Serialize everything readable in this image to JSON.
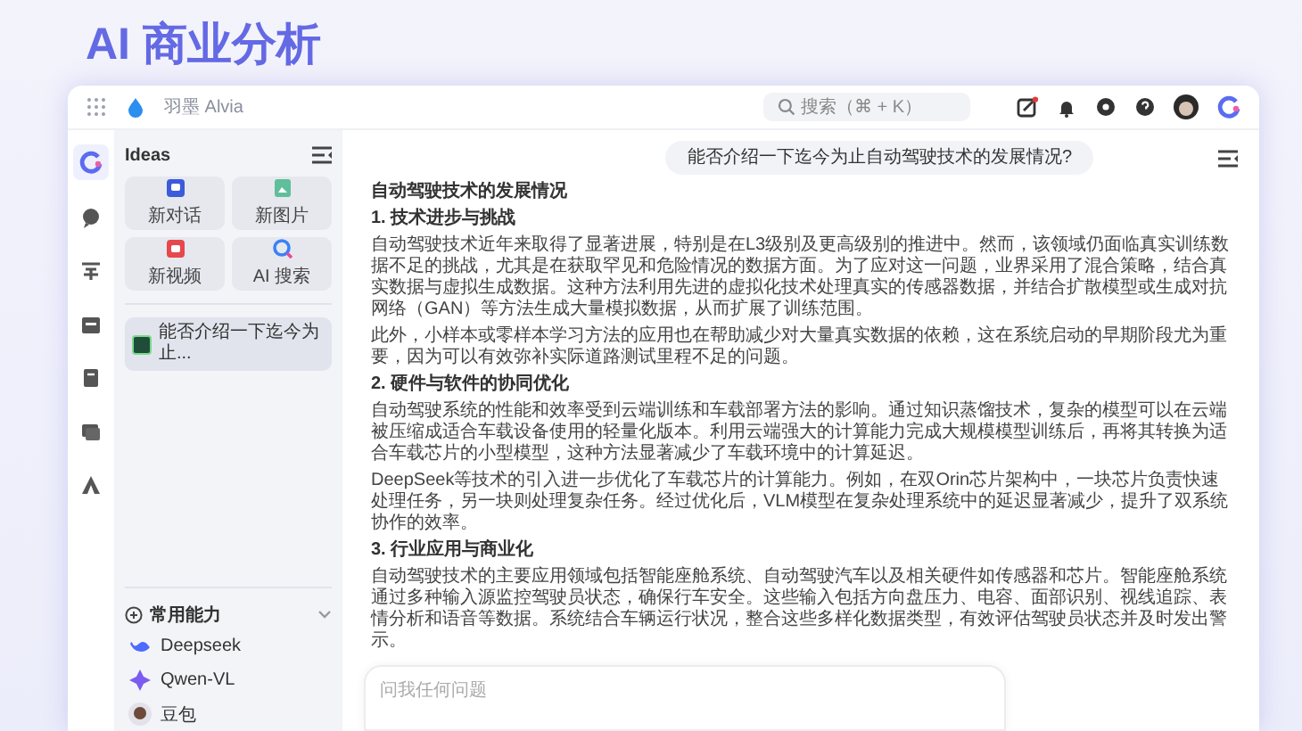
{
  "page_title": "AI 商业分析",
  "topbar": {
    "app_name": "羽墨 Alvia",
    "search": {
      "placeholder": "搜索（⌘ + K）"
    },
    "notification_dot": true
  },
  "rail": {
    "items": [
      {
        "kind": "logo",
        "selected": true
      },
      {
        "kind": "chat",
        "selected": false
      },
      {
        "kind": "list",
        "selected": false
      },
      {
        "kind": "calendar",
        "selected": false
      },
      {
        "kind": "note",
        "selected": false
      },
      {
        "kind": "message",
        "selected": false
      },
      {
        "kind": "triangle",
        "selected": false
      }
    ]
  },
  "sidebar": {
    "title": "Ideas",
    "tiles": [
      {
        "kind": "chat",
        "label": "新对话"
      },
      {
        "kind": "image",
        "label": "新图片"
      },
      {
        "kind": "video",
        "label": "新视频"
      },
      {
        "kind": "search",
        "label": "AI 搜索"
      }
    ],
    "history": [
      {
        "label": "能否介绍一下迄今为止...",
        "selected": true
      }
    ],
    "section": {
      "label": "常用能力",
      "expanded": true,
      "items": [
        {
          "kind": "whale",
          "label": "Deepseek"
        },
        {
          "kind": "star",
          "label": "Qwen-VL"
        },
        {
          "kind": "avatar",
          "label": "豆包"
        }
      ]
    }
  },
  "chat": {
    "question": "能否介绍一下迄今为止自动驾驶技术的发展情况?",
    "answer": [
      {
        "kind": "title",
        "text": "自动驾驶技术的发展情况"
      },
      {
        "kind": "heading",
        "text": "1. 技术进步与挑战"
      },
      {
        "kind": "paragraph",
        "text": "自动驾驶技术近年来取得了显著进展，特别是在L3级别及更高级别的推进中。然而，该领域仍面临真实训练数据不足的挑战，尤其是在获取罕见和危险情况的数据方面。为了应对这一问题，业界采用了混合策略，结合真实数据与虚拟生成数据。这种方法利用先进的虚拟化技术处理真实的传感器数据，并结合扩散模型或生成对抗网络（GAN）等方法生成大量模拟数据，从而扩展了训练范围。"
      },
      {
        "kind": "paragraph",
        "text": "此外，小样本或零样本学习方法的应用也在帮助减少对大量真实数据的依赖，这在系统启动的早期阶段尤为重要，因为可以有效弥补实际道路测试里程不足的问题。"
      },
      {
        "kind": "heading",
        "text": "2. 硬件与软件的协同优化"
      },
      {
        "kind": "paragraph",
        "text": "自动驾驶系统的性能和效率受到云端训练和车载部署方法的影响。通过知识蒸馏技术，复杂的模型可以在云端被压缩成适合车载设备使用的轻量化版本。利用云端强大的计算能力完成大规模模型训练后，再将其转换为适合车载芯片的小型模型，这种方法显著减少了车载环境中的计算延迟。"
      },
      {
        "kind": "paragraph",
        "text": "DeepSeek等技术的引入进一步优化了车载芯片的计算能力。例如，在双Orin芯片架构中，一块芯片负责快速处理任务，另一块则处理复杂任务。经过优化后，VLM模型在复杂处理系统中的延迟显著减少，提升了双系统协作的效率。"
      },
      {
        "kind": "heading",
        "text": "3. 行业应用与商业化"
      },
      {
        "kind": "paragraph",
        "text": "自动驾驶技术的主要应用领域包括智能座舱系统、自动驾驶汽车以及相关硬件如传感器和芯片。智能座舱系统通过多种输入源监控驾驶员状态，确保行车安全。这些输入包括方向盘压力、电容、面部识别、视线追踪、表情分析和语音等数据。系统结合车辆运行状况，整合这些多样化数据类型，有效评估驾驶员状态并及时发出警示。"
      }
    ],
    "input": {
      "placeholder": "问我任何问题"
    }
  }
}
